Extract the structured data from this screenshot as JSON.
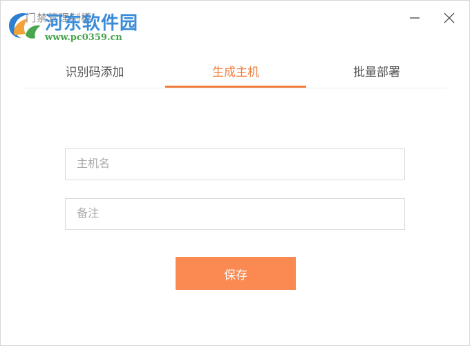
{
  "window": {
    "title": "门禁管理制模",
    "watermark_name": "河东软件园",
    "watermark_url": "www.pc0359.cn"
  },
  "tabs": [
    {
      "label": "识别码添加",
      "active": false
    },
    {
      "label": "生成主机",
      "active": true
    },
    {
      "label": "批量部署",
      "active": false
    }
  ],
  "form": {
    "host_name": {
      "value": "",
      "placeholder": "主机名"
    },
    "remark": {
      "value": "",
      "placeholder": "备注"
    },
    "save_label": "保存"
  },
  "colors": {
    "accent": "#f07d3c",
    "button": "#fa8952",
    "watermark_blue": "#3a8bd8",
    "watermark_green": "#45a34a"
  },
  "icons": {
    "logo": "pc0359-logo-icon",
    "minimize": "minimize-icon",
    "close": "close-icon"
  }
}
